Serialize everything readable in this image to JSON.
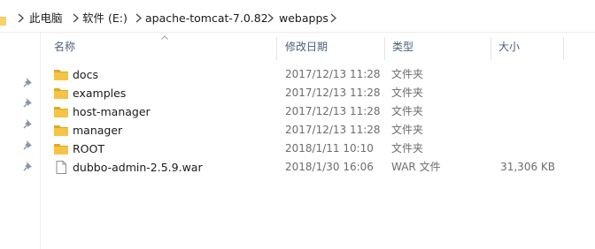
{
  "breadcrumb": {
    "items": [
      "此电脑",
      "软件 (E:)",
      "apache-tomcat-7.0.82",
      "webapps"
    ]
  },
  "columns": {
    "name": "名称",
    "date": "修改日期",
    "type": "类型",
    "size": "大小"
  },
  "files": [
    {
      "name": "docs",
      "date": "2017/12/13 11:28",
      "type": "文件夹",
      "size": "",
      "icon": "folder-icon"
    },
    {
      "name": "examples",
      "date": "2017/12/13 11:28",
      "type": "文件夹",
      "size": "",
      "icon": "folder-icon"
    },
    {
      "name": "host-manager",
      "date": "2017/12/13 11:28",
      "type": "文件夹",
      "size": "",
      "icon": "folder-icon"
    },
    {
      "name": "manager",
      "date": "2017/12/13 11:28",
      "type": "文件夹",
      "size": "",
      "icon": "folder-icon"
    },
    {
      "name": "ROOT",
      "date": "2018/1/11 10:10",
      "type": "文件夹",
      "size": "",
      "icon": "folder-icon"
    },
    {
      "name": "dubbo-admin-2.5.9.war",
      "date": "2018/1/30 16:06",
      "type": "WAR 文件",
      "size": "31,306 KB",
      "icon": "file-icon"
    }
  ],
  "colors": {
    "folder": "#f5c445",
    "folder_dark": "#dfa826",
    "header_text": "#4c607a",
    "muted_text": "#6d6d6d"
  }
}
